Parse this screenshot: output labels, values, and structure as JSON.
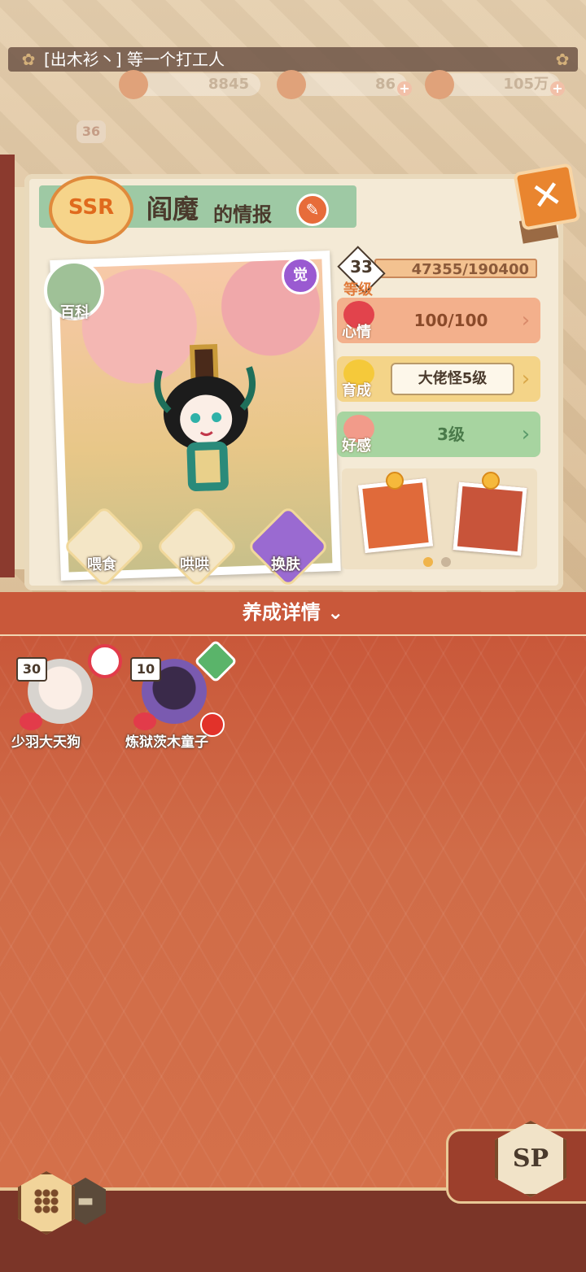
{
  "header": {
    "player_name": "[出木衫丶] 等一个打工人",
    "resources": [
      {
        "name": "gouyu",
        "value": "8845"
      },
      {
        "name": "stamina",
        "value": "86"
      },
      {
        "name": "coins",
        "value": "105万"
      }
    ],
    "level_badge": "36"
  },
  "panel": {
    "rarity": "SSR",
    "title": "阎魔",
    "title_suffix": "的情报",
    "encyclopedia_label": "百科",
    "awaken_badge": "觉",
    "actions": [
      {
        "label": "喂食",
        "icon": "noodle-icon"
      },
      {
        "label": "哄哄",
        "icon": "milk-icon"
      },
      {
        "label": "换肤",
        "icon": "kimono-icon"
      }
    ],
    "stats": {
      "level": "33",
      "level_label": "等级",
      "exp": "47355/190400",
      "mood_label": "心情",
      "mood_value": "100/100",
      "growth_label": "育成",
      "growth_value": "大佬怪5级",
      "affection_label": "好感",
      "affection_value": "3级"
    }
  },
  "detail": {
    "label": "养成详情"
  },
  "shikigami": [
    {
      "level": "30",
      "name": "少羽大天狗"
    },
    {
      "level": "10",
      "name": "炼狱茨木童子"
    }
  ],
  "footer": {
    "sp_label": "SP"
  },
  "colors": {
    "accent": "#e9852f",
    "bottom_bg": "#c9583a",
    "mood": "#f3b08c",
    "growth": "#f4d488",
    "affection": "#a7d4a0"
  }
}
